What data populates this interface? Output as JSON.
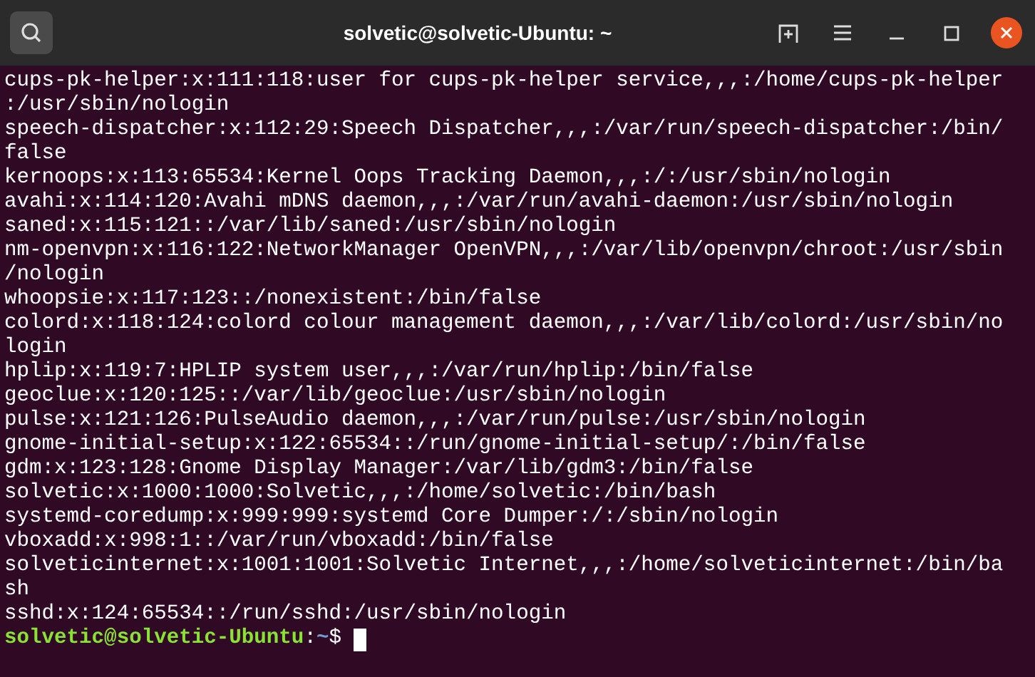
{
  "window": {
    "title": "solvetic@solvetic-Ubuntu: ~"
  },
  "terminal": {
    "lines": [
      "cups-pk-helper:x:111:118:user for cups-pk-helper service,,,:/home/cups-pk-helper",
      ":/usr/sbin/nologin",
      "speech-dispatcher:x:112:29:Speech Dispatcher,,,:/var/run/speech-dispatcher:/bin/",
      "false",
      "kernoops:x:113:65534:Kernel Oops Tracking Daemon,,,:/:/usr/sbin/nologin",
      "avahi:x:114:120:Avahi mDNS daemon,,,:/var/run/avahi-daemon:/usr/sbin/nologin",
      "saned:x:115:121::/var/lib/saned:/usr/sbin/nologin",
      "nm-openvpn:x:116:122:NetworkManager OpenVPN,,,:/var/lib/openvpn/chroot:/usr/sbin",
      "/nologin",
      "whoopsie:x:117:123::/nonexistent:/bin/false",
      "colord:x:118:124:colord colour management daemon,,,:/var/lib/colord:/usr/sbin/no",
      "login",
      "hplip:x:119:7:HPLIP system user,,,:/var/run/hplip:/bin/false",
      "geoclue:x:120:125::/var/lib/geoclue:/usr/sbin/nologin",
      "pulse:x:121:126:PulseAudio daemon,,,:/var/run/pulse:/usr/sbin/nologin",
      "gnome-initial-setup:x:122:65534::/run/gnome-initial-setup/:/bin/false",
      "gdm:x:123:128:Gnome Display Manager:/var/lib/gdm3:/bin/false",
      "solvetic:x:1000:1000:Solvetic,,,:/home/solvetic:/bin/bash",
      "systemd-coredump:x:999:999:systemd Core Dumper:/:/sbin/nologin",
      "vboxadd:x:998:1::/var/run/vboxadd:/bin/false",
      "solveticinternet:x:1001:1001:Solvetic Internet,,,:/home/solveticinternet:/bin/ba",
      "sh",
      "sshd:x:124:65534::/run/sshd:/usr/sbin/nologin"
    ],
    "prompt": {
      "user_host": "solvetic@solvetic-Ubuntu",
      "separator": ":",
      "path": "~",
      "symbol": "$"
    }
  }
}
